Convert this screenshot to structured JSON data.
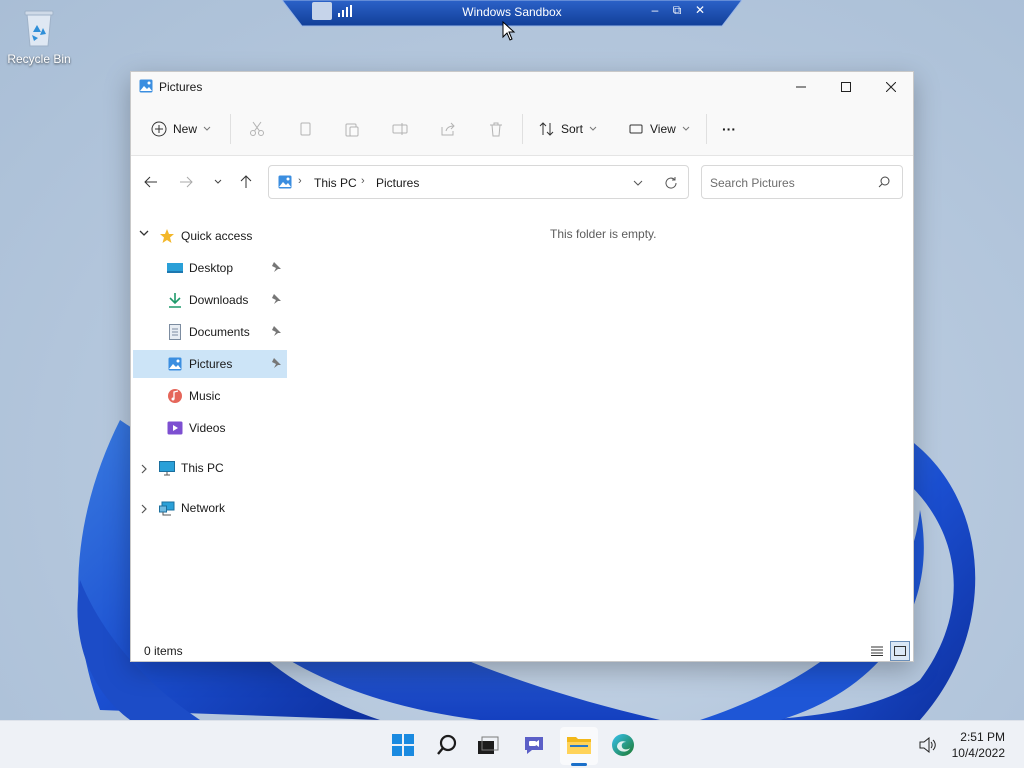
{
  "desktop": {
    "recycle_bin_label": "Recycle Bin"
  },
  "sandbox_bar": {
    "title": "Windows Sandbox",
    "minimize": "–",
    "restore": "⧉",
    "close": "✕"
  },
  "window": {
    "title": "Pictures",
    "min_glyph": "—",
    "close_glyph": "✕"
  },
  "commandbar": {
    "new_label": "New",
    "sort_label": "Sort",
    "view_label": "View",
    "more_label": "···"
  },
  "address": {
    "crumbs": [
      "This PC",
      "Pictures"
    ],
    "sep": "›",
    "dropdown": "⌄"
  },
  "search": {
    "placeholder": "Search Pictures"
  },
  "navpane": {
    "quick_access": "Quick access",
    "items": [
      {
        "label": "Desktop",
        "icon": "desktop-icon"
      },
      {
        "label": "Downloads",
        "icon": "downloads-icon"
      },
      {
        "label": "Documents",
        "icon": "documents-icon"
      },
      {
        "label": "Pictures",
        "icon": "pictures-icon",
        "selected": true
      },
      {
        "label": "Music",
        "icon": "music-icon"
      },
      {
        "label": "Videos",
        "icon": "videos-icon"
      }
    ],
    "this_pc": "This PC",
    "network": "Network",
    "expanded_glyph": "⌄",
    "collapsed_glyph": "›"
  },
  "content": {
    "empty_message": "This folder is empty."
  },
  "statusbar": {
    "item_count": "0 items"
  },
  "taskbar": {
    "time": "2:51 PM",
    "date": "10/4/2022"
  },
  "colors": {
    "accent": "#0067c0",
    "selection": "#cce4f7"
  }
}
